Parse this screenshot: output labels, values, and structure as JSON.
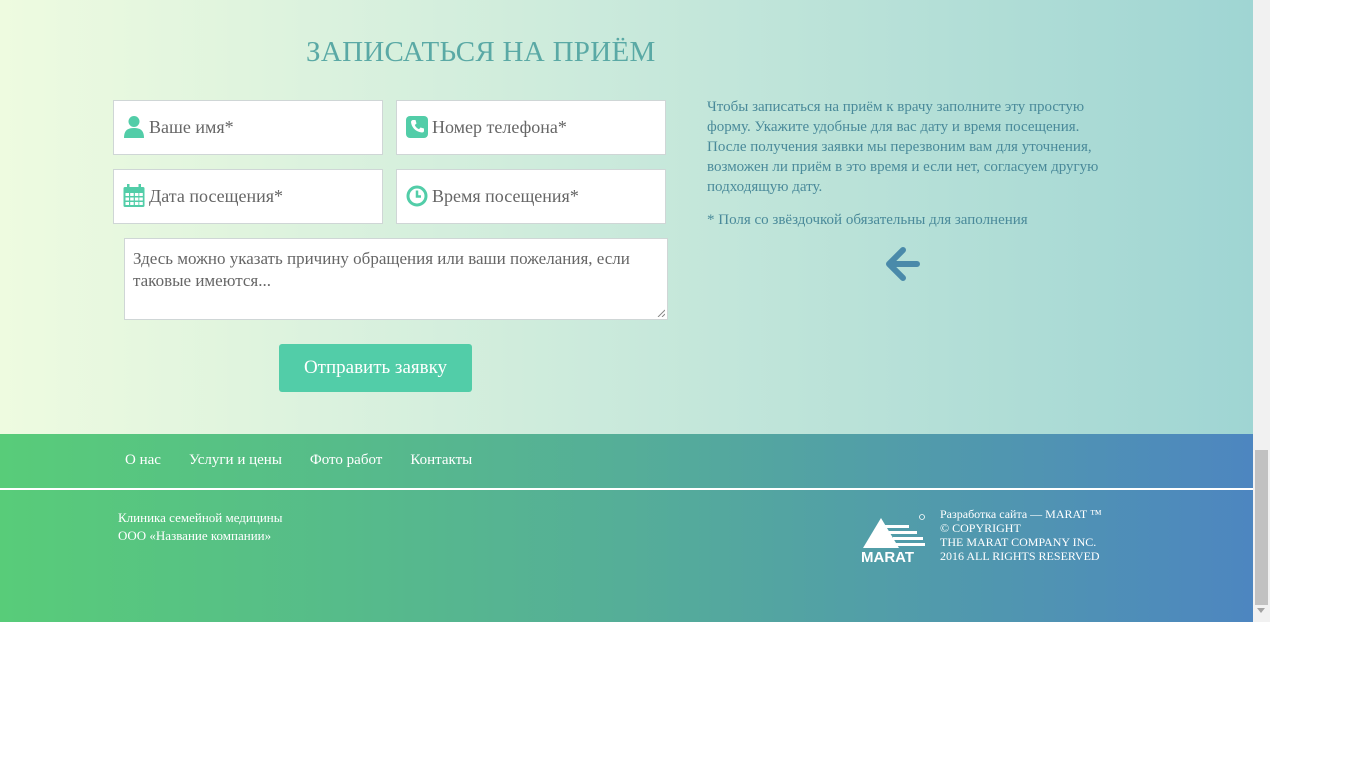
{
  "form": {
    "title": "ЗАПИСАТЬСЯ НА ПРИЁМ",
    "name_placeholder": "Ваше имя*",
    "phone_placeholder": "Номер телефона*",
    "date_placeholder": "Дата посещения*",
    "time_placeholder": "Время посещения*",
    "message_placeholder": "Здесь можно указать причину обращения или ваши пожелания, если таковые имеются...",
    "submit_label": "Отправить заявку"
  },
  "info": {
    "text": "Чтобы записаться на приём к врачу заполните эту простую форму. Укажите удобные для вас дату и время посещения. После получения заявки мы перезвоним вам для уточнения, возможен ли приём в это время и если нет, согласуем другую подходящую дату.",
    "note": "* Поля со звёздочкой обязательны для заполнения"
  },
  "footer": {
    "nav": [
      "О нас",
      "Услуги и цены",
      "Фото работ",
      "Контакты"
    ],
    "company_line1": "Клиника семейной медицины",
    "company_line2": "ООО «Название компании»",
    "dev_line1": "Разработка сайта — MARAT ™",
    "dev_line2": "© COPYRIGHT",
    "dev_line3": "THE MARAT COMPANY INC.",
    "dev_line4": "2016 ALL RIGHTS RESERVED",
    "logo_text": "MARAT"
  },
  "colors": {
    "accent": "#52cda8",
    "title": "#5aa9a5",
    "info_text": "#4a8a9a",
    "arrow": "#4a8aaa"
  },
  "icons": {
    "name": "user-icon",
    "phone": "phone-icon",
    "date": "calendar-icon",
    "time": "clock-icon",
    "pointer": "arrow-left-icon"
  }
}
